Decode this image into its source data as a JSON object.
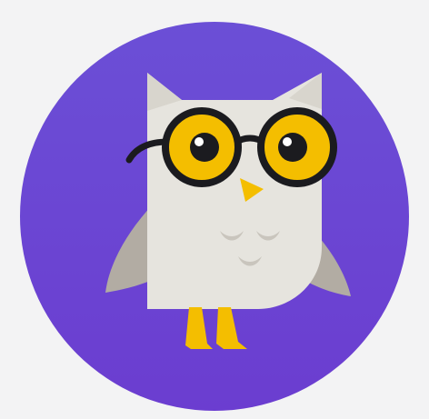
{
  "app_icon": {
    "icon_name": "owl-mascot-icon",
    "colors": {
      "page_background": "#f3f3f4",
      "circle_top": "#6b4fd6",
      "circle_bottom": "#6b3dd0",
      "owl_body": "#e6e4de",
      "owl_wing": "#b2aca3",
      "owl_ear_shadow": "#d8d5cd",
      "glasses_frame": "#1b1b1f",
      "lens": "#f4be00",
      "pupil": "#1b1b1f",
      "beak": "#f4be00",
      "feet": "#f4be00",
      "feather_marks": "#c9c5bd"
    }
  }
}
